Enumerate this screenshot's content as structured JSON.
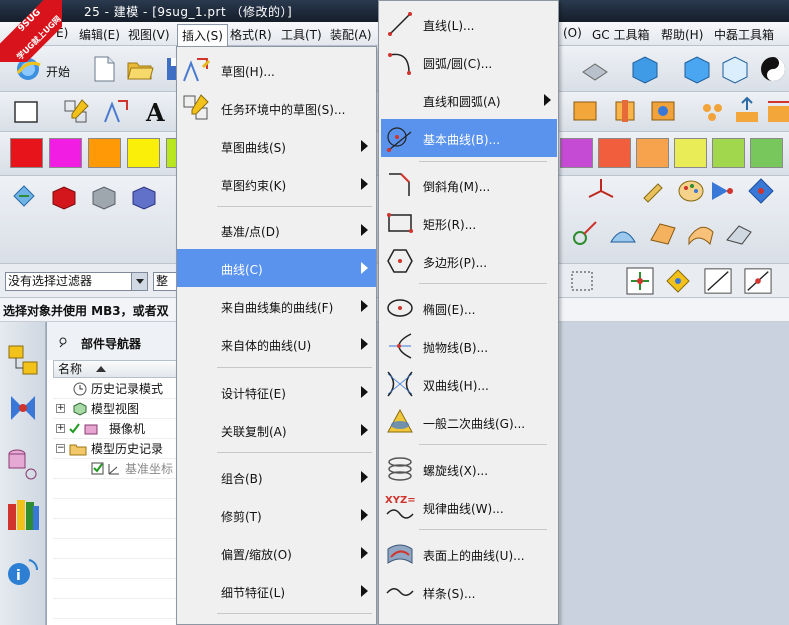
{
  "window": {
    "title": "25 - 建模 - [9sug_1.prt （修改的）]",
    "logo_line1": "9SUG",
    "logo_line2": "学UG就上UG网"
  },
  "menubar": {
    "items": [
      "E)",
      "编辑(E)",
      "视图(V)",
      "插入(S)",
      "格式(R)",
      "工具(T)",
      "装配(A)"
    ],
    "right_items": [
      "(O)",
      "GC 工具箱",
      "帮助(H)",
      "中磊工具箱"
    ]
  },
  "toolbar": {
    "start_label": "开始",
    "swatch_colors": [
      "#e8141b",
      "#f21de3",
      "#ff9a06",
      "#f9ef09",
      "#b9e71f",
      "#2ed73c",
      "#c64bd4",
      "#f05e3e",
      "#f7a24d",
      "#e9ec57",
      "#a0d74d",
      "#78c75d"
    ]
  },
  "filter": {
    "selection_filter": "没有选择过滤器",
    "second_combo": "整"
  },
  "status": {
    "prompt": "选择对象并使用 MB3，或者双"
  },
  "navigator": {
    "title": "部件导航器",
    "column_name": "名称",
    "rows": [
      {
        "label": "历史记录模式"
      },
      {
        "label": "模型视图"
      },
      {
        "label": "摄像机"
      },
      {
        "label": "模型历史记录"
      },
      {
        "label": "基准坐标"
      }
    ]
  },
  "insert_menu": {
    "items": [
      {
        "label": "草图(H)...",
        "submenu": false
      },
      {
        "label": "任务环境中的草图(S)...",
        "submenu": false
      },
      {
        "label": "草图曲线(S)",
        "submenu": true
      },
      {
        "label": "草图约束(K)",
        "submenu": true
      },
      {
        "label": "基准/点(D)",
        "submenu": true
      },
      {
        "label": "曲线(C)",
        "submenu": true,
        "highlighted": true
      },
      {
        "label": "来自曲线集的曲线(F)",
        "submenu": true
      },
      {
        "label": "来自体的曲线(U)",
        "submenu": true
      },
      {
        "label": "设计特征(E)",
        "submenu": true
      },
      {
        "label": "关联复制(A)",
        "submenu": true
      },
      {
        "label": "组合(B)",
        "submenu": true
      },
      {
        "label": "修剪(T)",
        "submenu": true
      },
      {
        "label": "偏置/缩放(O)",
        "submenu": true
      },
      {
        "label": "细节特征(L)",
        "submenu": true
      }
    ]
  },
  "curve_menu": {
    "items": [
      {
        "label": "直线(L)...",
        "icon": "line-icon"
      },
      {
        "label": "圆弧/圆(C)...",
        "icon": "arc-icon"
      },
      {
        "label": "直线和圆弧(A)",
        "icon": "",
        "submenu": true
      },
      {
        "label": "基本曲线(B)...",
        "icon": "basic-curve-icon",
        "highlighted": true
      },
      {
        "label": "倒斜角(M)...",
        "icon": "chamfer-icon"
      },
      {
        "label": "矩形(R)...",
        "icon": "rectangle-icon"
      },
      {
        "label": "多边形(P)...",
        "icon": "polygon-icon"
      },
      {
        "label": "椭圆(E)...",
        "icon": "ellipse-icon"
      },
      {
        "label": "抛物线(B)...",
        "icon": "parabola-icon"
      },
      {
        "label": "双曲线(H)...",
        "icon": "hyperbola-icon"
      },
      {
        "label": "一般二次曲线(G)...",
        "icon": "conic-icon"
      },
      {
        "label": "螺旋线(X)...",
        "icon": "helix-icon"
      },
      {
        "label": "规律曲线(W)...",
        "icon": "law-curve-icon",
        "icon_text": "XYZ="
      },
      {
        "label": "表面上的曲线(U)...",
        "icon": "curve-on-surface-icon"
      },
      {
        "label": "样条(S)...",
        "icon": "spline-icon"
      }
    ]
  }
}
